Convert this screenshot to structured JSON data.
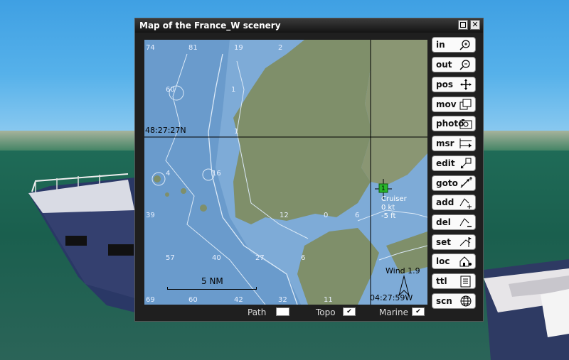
{
  "window": {
    "title": "Map of the France_W scenery"
  },
  "tools": [
    {
      "label": "in",
      "icon": "zoom-in-icon"
    },
    {
      "label": "out",
      "icon": "zoom-out-icon"
    },
    {
      "label": "pos",
      "icon": "move-cross-icon"
    },
    {
      "label": "mov",
      "icon": "windows-stack-icon"
    },
    {
      "label": "photo",
      "icon": "camera-icon"
    },
    {
      "label": "msr",
      "icon": "measure-icon"
    },
    {
      "label": "edit",
      "icon": "edit-resize-icon"
    },
    {
      "label": "goto",
      "icon": "goto-arrow-icon"
    },
    {
      "label": "add",
      "icon": "add-waypoint-icon"
    },
    {
      "label": "del",
      "icon": "delete-waypoint-icon"
    },
    {
      "label": "set",
      "icon": "set-flag-icon"
    },
    {
      "label": "loc",
      "icon": "location-house-icon"
    },
    {
      "label": "ttl",
      "icon": "document-list-icon"
    },
    {
      "label": "scn",
      "icon": "globe-icon"
    }
  ],
  "map": {
    "latitude": "48:27:27N",
    "longitude": "04:27:59W",
    "scale": "5 NM",
    "wind": "Wind 1.9",
    "vessel": {
      "marker": "1",
      "name": "Cruiser",
      "speed": "0 kt",
      "depth": "-5 ft"
    },
    "depths": [
      "74",
      "81",
      "19",
      "2",
      "60",
      "1",
      "1",
      "4",
      "16",
      "39",
      "12",
      "0",
      "6",
      "57",
      "40",
      "27",
      "6",
      "69",
      "60",
      "42",
      "32",
      "11"
    ]
  },
  "options": {
    "path_label": "Path",
    "topo_label": "Topo",
    "marine_label": "Marine",
    "topo_checked": "✔",
    "marine_checked": "✔"
  },
  "colors": {
    "sea": "#6a9bcc",
    "land": "#7f8f6a",
    "contour": "#dbe9f7",
    "vessel": "#29b52a"
  }
}
